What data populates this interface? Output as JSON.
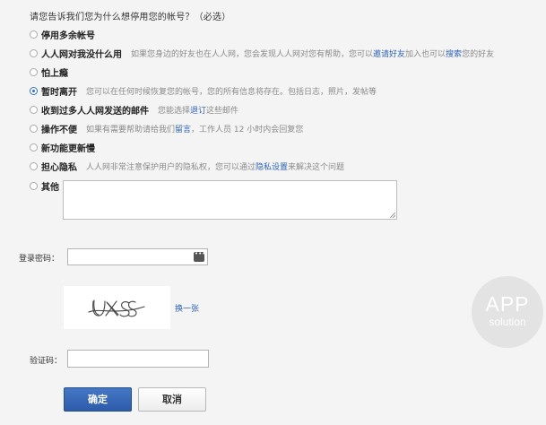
{
  "question": "请您告诉我们您为什么想停用您的帐号？（必选）",
  "options": [
    {
      "label": "停用多余帐号",
      "desc": ""
    },
    {
      "label": "人人网对我没什么用",
      "desc_pre": "如果您身边的好友也在人人网，您会发现人人网对您有帮助，您可以",
      "link1": "邀请好友",
      "desc_mid": "加入也可以",
      "link2": "搜索",
      "desc_post": "您的好友"
    },
    {
      "label": "怕上瘾",
      "desc": ""
    },
    {
      "label": "暂时离开",
      "desc": "您可以在任何时候恢复您的帐号，您的所有信息将存在。包括日志，照片，发帖等"
    },
    {
      "label": "收到过多人人网发送的邮件",
      "desc_pre": "您能选择",
      "link1": "退订",
      "desc_post": "这些邮件"
    },
    {
      "label": "操作不便",
      "desc_pre": "如果有需要帮助请给我们",
      "link1": "留言",
      "desc_post": "，工作人员 12 小时内会回复您"
    },
    {
      "label": "新功能更新慢",
      "desc": ""
    },
    {
      "label": "担心隐私",
      "desc_pre": "人人网非常注意保护用户的隐私权，您可以通过",
      "link1": "隐私设置",
      "desc_post": "来解决这个问题"
    },
    {
      "label": "其他",
      "desc": ""
    }
  ],
  "selected_option_index": 3,
  "password_label": "登录密码：",
  "password_value": "",
  "captcha_text": "UXS",
  "captcha_refresh_label": "换一张",
  "code_label": "验证码：",
  "code_value": "",
  "confirm_button": "确定",
  "cancel_button": "取消",
  "watermark": {
    "title": "APP",
    "subtitle": "solution"
  },
  "colors": {
    "link": "#2d63b3",
    "primary": "#3265b5"
  }
}
